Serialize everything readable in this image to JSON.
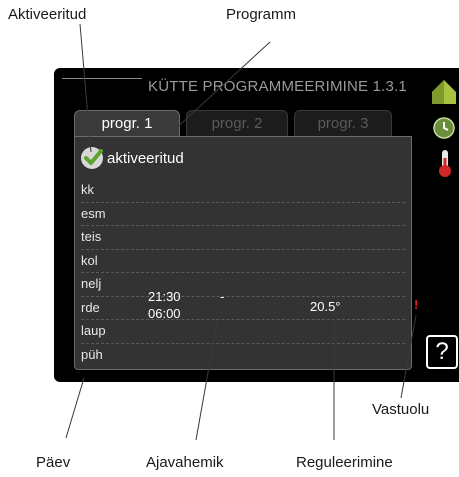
{
  "callouts": {
    "activated": "Aktiveeritud",
    "program": "Programm",
    "conflict": "Vastuolu",
    "day": "Päev",
    "time_period": "Ajavahemik",
    "adjustment": "Reguleerimine"
  },
  "screen": {
    "title": "KÜTTE PROGRAMMEERIMINE 1.3.1",
    "tabs": [
      "progr. 1",
      "progr. 2",
      "progr. 3"
    ],
    "active_tab": "progr. 1",
    "activated_label": "aktiveeritud",
    "days": [
      "kk",
      "esm",
      "teis",
      "kol",
      "nelj",
      "rde",
      "laup",
      "püh"
    ],
    "schedule": {
      "day": "rde",
      "start": "21:30",
      "dash": "-",
      "end": "06:00",
      "value": "20.5°"
    },
    "conflict_mark": "!",
    "help_symbol": "?"
  },
  "icons": {
    "side": [
      "house-icon",
      "clock-icon",
      "thermometer-icon"
    ],
    "check": "check-icon",
    "help": "help-icon"
  },
  "colors": {
    "screen_background": "#000000",
    "panel": "#333333",
    "check": "#5aa52a",
    "conflict": "#e02020",
    "house": "#a9c23f",
    "clock": "#6b8e3a",
    "thermometer": "#d02828"
  }
}
